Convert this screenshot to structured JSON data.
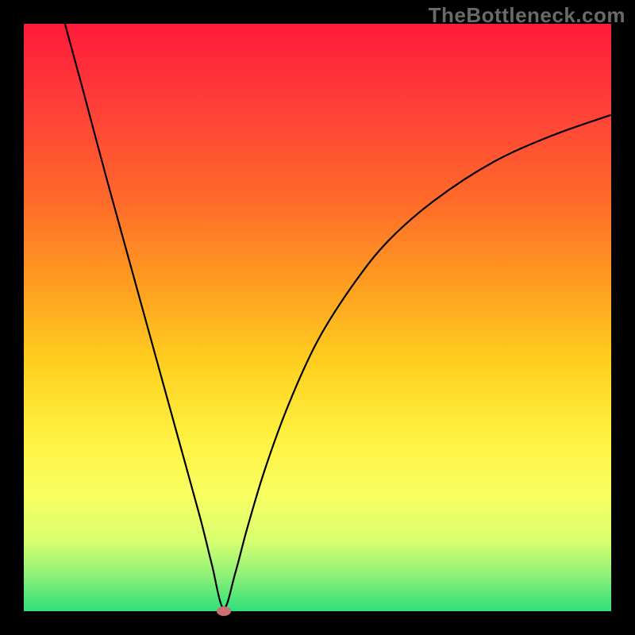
{
  "watermark": "TheBottleneck.com",
  "colors": {
    "frame": "#000000",
    "curve": "#000000",
    "marker": "#cc6f6f",
    "gradient_top": "#ff1a3a",
    "gradient_bottom": "#2de07a"
  },
  "chart_data": {
    "type": "line",
    "title": "",
    "xlabel": "",
    "ylabel": "",
    "xlim": [
      0,
      100
    ],
    "ylim": [
      0,
      100
    ],
    "min_point": {
      "x": 34,
      "y": 0
    },
    "curve_points": [
      {
        "x": 7.0,
        "y": 100.0
      },
      {
        "x": 10.0,
        "y": 89.0
      },
      {
        "x": 14.0,
        "y": 74.0
      },
      {
        "x": 18.0,
        "y": 59.5
      },
      {
        "x": 22.0,
        "y": 45.0
      },
      {
        "x": 26.0,
        "y": 30.5
      },
      {
        "x": 30.0,
        "y": 16.0
      },
      {
        "x": 32.0,
        "y": 8.0
      },
      {
        "x": 34.0,
        "y": 0.5
      },
      {
        "x": 36.0,
        "y": 6.5
      },
      {
        "x": 38.0,
        "y": 14.0
      },
      {
        "x": 41.0,
        "y": 24.0
      },
      {
        "x": 45.0,
        "y": 35.0
      },
      {
        "x": 50.0,
        "y": 46.0
      },
      {
        "x": 56.0,
        "y": 55.5
      },
      {
        "x": 62.0,
        "y": 63.0
      },
      {
        "x": 70.0,
        "y": 70.0
      },
      {
        "x": 80.0,
        "y": 76.5
      },
      {
        "x": 90.0,
        "y": 81.0
      },
      {
        "x": 100.0,
        "y": 84.5
      }
    ]
  }
}
